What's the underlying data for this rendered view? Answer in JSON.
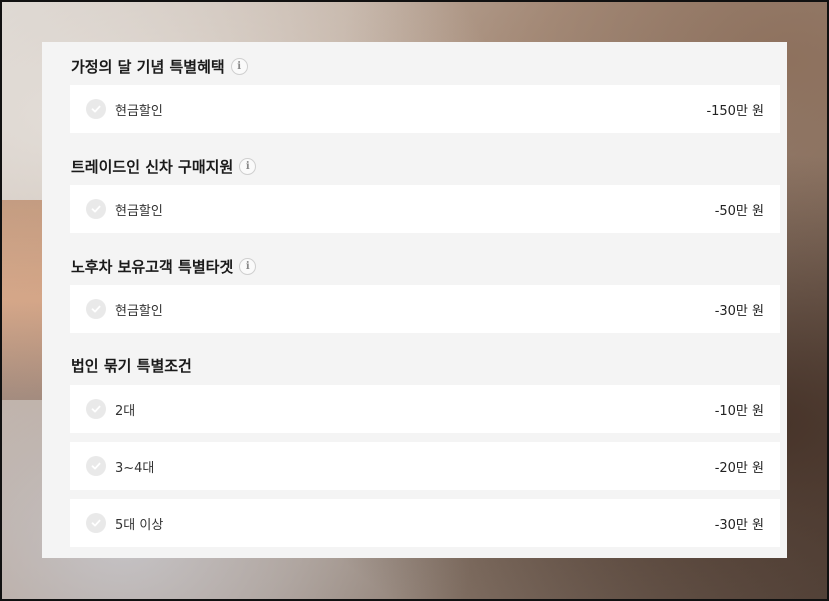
{
  "sections": [
    {
      "title": "가정의 달 기념 특별혜택",
      "has_info": true,
      "items": [
        {
          "label": "현금할인",
          "value": "-150만 원"
        }
      ]
    },
    {
      "title": "트레이드인 신차 구매지원",
      "has_info": true,
      "items": [
        {
          "label": "현금할인",
          "value": "-50만 원"
        }
      ]
    },
    {
      "title": "노후차 보유고객 특별타겟",
      "has_info": true,
      "items": [
        {
          "label": "현금할인",
          "value": "-30만 원"
        }
      ]
    },
    {
      "title": "법인 묶기 특별조건",
      "has_info": false,
      "items": [
        {
          "label": "2대",
          "value": "-10만 원"
        },
        {
          "label": "3~4대",
          "value": "-20만 원"
        },
        {
          "label": "5대 이상",
          "value": "-30만 원"
        }
      ]
    }
  ],
  "info_icon_glyph": "i",
  "colors": {
    "panel_bg": "#f4f4f4",
    "row_bg": "#ffffff",
    "check_bg": "#e9e9e9",
    "check_mark": "#ffffff",
    "title_text": "#1a1a1a"
  }
}
